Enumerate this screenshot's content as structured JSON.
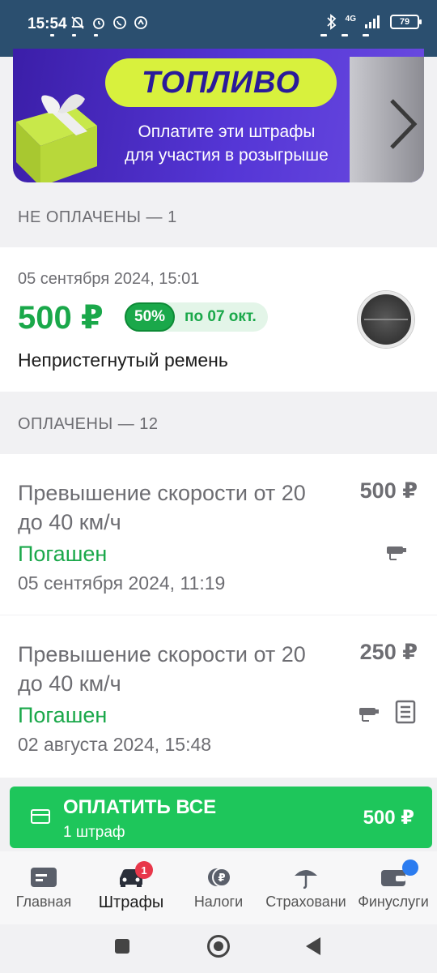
{
  "status_bar": {
    "time": "15:54",
    "battery": "79",
    "network": "4G"
  },
  "banner": {
    "title": "ТОПЛИВО",
    "line1": "Оплатите эти штрафы",
    "line2": "для участия в розыгрыше"
  },
  "unpaid": {
    "header": "НЕ ОПЛАЧЕНЫ — 1",
    "items": [
      {
        "date": "05 сентября 2024, 15:01",
        "amount": "500 ₽",
        "discount": "50%",
        "until": "по 07 окт.",
        "description": "Непристегнутый ремень"
      }
    ]
  },
  "paid": {
    "header": "ОПЛАЧЕНЫ — 12",
    "items": [
      {
        "title": "Превышение скорости от 20 до 40 км/ч",
        "amount": "500 ₽",
        "status": "Погашен",
        "date": "05 сентября 2024, 11:19"
      },
      {
        "title": "Превышение скорости от 20 до 40 км/ч",
        "amount": "250 ₽",
        "status": "Погашен",
        "date": "02 августа 2024, 15:48"
      }
    ]
  },
  "pay_all": {
    "label": "ОПЛАТИТЬ ВСЕ",
    "sub": "1 штраф",
    "total": "500 ₽"
  },
  "bottom_nav": {
    "items": [
      {
        "label": "Главная",
        "icon": "main-icon"
      },
      {
        "label": "Штрафы",
        "icon": "car-icon",
        "badge": "1"
      },
      {
        "label": "Налоги",
        "icon": "coin-icon"
      },
      {
        "label": "Страховани",
        "icon": "umbrella-icon"
      },
      {
        "label": "Финуслуги",
        "icon": "wallet-icon"
      }
    ]
  },
  "colors": {
    "accent": "#1aa84a",
    "button": "#1ec65b",
    "statusbar": "#2b4f6f",
    "badge": "#e8374a"
  }
}
